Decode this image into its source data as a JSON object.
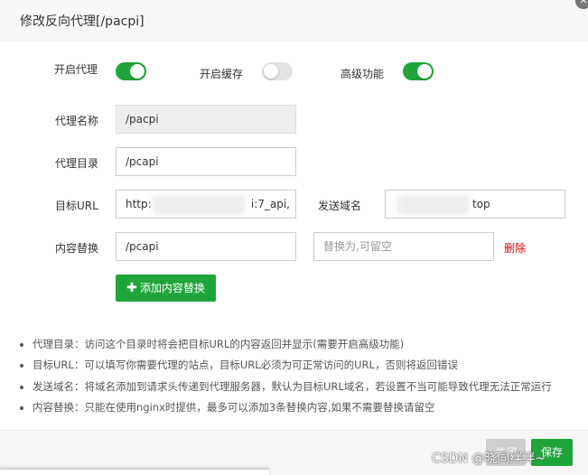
{
  "dialog": {
    "title": "修改反向代理[/pacpi]",
    "close_glyph": "✕"
  },
  "toggles": {
    "proxy": {
      "label": "开启代理",
      "state": true
    },
    "cache": {
      "label": "开启缓存",
      "state": false
    },
    "advanced": {
      "label": "高级功能",
      "state": true
    }
  },
  "form": {
    "proxy_name": {
      "label": "代理名称",
      "value": "/pacpi"
    },
    "proxy_dir": {
      "label": "代理目录",
      "value": "/pcapi"
    },
    "target_url": {
      "label": "目标URL",
      "value_start": "http:",
      "value_end": "i:7_api,"
    },
    "send_domain": {
      "label": "发送域名",
      "value_end": "top"
    },
    "content_replace": {
      "label": "内容替换",
      "value": "/pcapi",
      "replace_placeholder": "替换为,可留空",
      "delete_label": "删除"
    }
  },
  "add_button": {
    "icon": "plus-icon",
    "label": "添加内容替换"
  },
  "notes": [
    "代理目录：访问这个目录时将会把目标URL的内容返回并显示(需要开启高级功能)",
    "目标URL：可以填写你需要代理的站点，目标URL必须为可正常访问的URL，否则将返回错误",
    "发送域名：将域名添加到请求头传递到代理服务器，默认为目标URL域名，若设置不当可能导致代理无法正常运行",
    "内容替换：只能在使用nginx时提供，最多可以添加3条替换内容,如果不需要替换请留空"
  ],
  "footer": {
    "close_label": "关闭",
    "submit_label": "保存"
  },
  "watermark": "CSDN @晓同绊绊~",
  "colors": {
    "accent": "#20a53a",
    "danger": "#ee0000",
    "toggle_off": "#e3e3e3"
  }
}
